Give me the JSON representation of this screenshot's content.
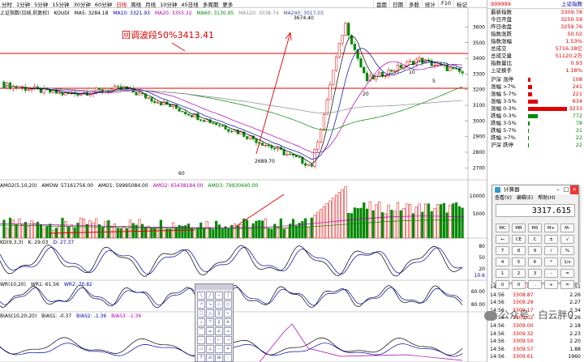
{
  "toolbar": {
    "items": [
      "分时",
      "1分钟",
      "5分钟",
      "15分钟",
      "30分钟",
      "60分钟",
      "日线",
      "周线",
      "月线",
      "10分钟",
      "45日线",
      "多周期",
      "更多"
    ],
    "active_index": 6,
    "right_tabs": [
      "盘面",
      "日期",
      "多股",
      "统计",
      "F10",
      "标记"
    ]
  },
  "main_indicator": {
    "title": "上证指数(日线,前复权)",
    "ma_label": "KOUDI",
    "ma5": "MA5: 3284.18",
    "ma10": "MA10: 3321.93",
    "ma20": "MA20: 3355.32",
    "ma60": "MA60: 3130.95",
    "ma120": "MA120: 3038.74",
    "ma240": "MA240: 3017.03"
  },
  "annotation": {
    "text": "回调波段50%3413.41"
  },
  "price_labels": {
    "high": "3674.40",
    "low": "2689.70",
    "mark_60": "60",
    "mark_20": "20",
    "mark_10": "10",
    "mark_5": "5"
  },
  "y_axis_main": [
    "3600",
    "3500",
    "3400",
    "3300",
    "3200",
    "3100",
    "3000",
    "2900",
    "2800",
    "2700"
  ],
  "vol_indicator": {
    "title": "AMO2(5,10,20)",
    "amo": "AMOW: 57161756.00",
    "amo1": "AMO1: 59995084.00",
    "amo2": "AMO2: 65438184.00",
    "amo3": "AMO3: 79930640.00"
  },
  "y_axis_vol": [
    "10000",
    "5000"
  ],
  "kdj_indicator": {
    "title": "KD(9,3,3)",
    "k": "K: 29.03",
    "d": "D: 27.37"
  },
  "y_axis_kdj": [
    "80",
    "50",
    "20",
    "10.6"
  ],
  "wr_indicator": {
    "title": "WR(10,20)",
    "wr1": "WR1: 61.56",
    "wr2": "WR2: 70.82"
  },
  "y_axis_wr": [
    "60.00",
    "80.00"
  ],
  "bias_indicator": {
    "title": "BIAS(10,20,20)",
    "b1": "BIAS1: -0.37",
    "b2": "BIAS2: -1.36",
    "b3": "BIAS3: -1.36"
  },
  "side": {
    "header_code": "999999",
    "header_name": "上证指数",
    "quotes": [
      {
        "label": "最新指数",
        "value": "3309.78"
      },
      {
        "label": "今日开盘",
        "value": "3250.59"
      },
      {
        "label": "昨日收盘",
        "value": "3259.76"
      },
      {
        "label": "指数涨跌",
        "value": "50.02"
      },
      {
        "label": "指数涨幅",
        "value": "1.53%"
      },
      {
        "label": "总成交",
        "value": "5716.18亿"
      },
      {
        "label": "总成交量",
        "value": "51120.2万"
      },
      {
        "label": "指数量比",
        "value": "0.93"
      },
      {
        "label": "上证换手",
        "value": "1.18%"
      }
    ],
    "dist": [
      {
        "label": "沪深 涨停",
        "value": "108",
        "color": "#e00000",
        "w": 3
      },
      {
        "label": "涨幅 >7%",
        "value": "241",
        "color": "#e00000",
        "w": 5
      },
      {
        "label": "涨幅 5-7%",
        "value": "221",
        "color": "#e00000",
        "w": 5
      },
      {
        "label": "涨幅 3-5%",
        "value": "634",
        "color": "#e00000",
        "w": 12
      },
      {
        "label": "涨幅 0-3%",
        "value": "3233",
        "color": "#e00000",
        "w": 48
      },
      {
        "label": "跌幅 0-3%",
        "value": "772",
        "color": "#080",
        "w": 12
      },
      {
        "label": "跌幅 3-5%",
        "value": "78",
        "color": "#080",
        "w": 2
      },
      {
        "label": "跌幅 5-7%",
        "value": "31",
        "color": "#080",
        "w": 1
      },
      {
        "label": "跌幅 >7%",
        "value": "22",
        "color": "#080",
        "w": 1
      },
      {
        "label": "沪深 跌停",
        "value": "22",
        "color": "#080",
        "w": 1
      }
    ]
  },
  "calculator": {
    "title": "计算器",
    "menu": [
      "查看(V)",
      "编辑(E)",
      "帮助(H)"
    ],
    "display": "3317.615",
    "keys": [
      "MC",
      "MR",
      "MS",
      "M+",
      "M-",
      "←",
      "CE",
      "C",
      "±",
      "√",
      "7",
      "8",
      "9",
      "/",
      "%",
      "4",
      "5",
      "6",
      "*",
      "1/x",
      "1",
      "2",
      "3",
      "-",
      "=",
      "0",
      "0",
      ".",
      "+",
      "="
    ]
  },
  "trades": [
    {
      "t": "14:56",
      "p": "3308.87",
      "v": "2.51"
    },
    {
      "t": "14:56",
      "p": "3308.87",
      "v": "2.26"
    },
    {
      "t": "14:56",
      "p": "3309.29",
      "v": "2.27"
    },
    {
      "t": "14:56",
      "p": "3309.17",
      "v": "2.34"
    },
    {
      "t": "14:56",
      "p": "3309.02",
      "v": "2.26"
    },
    {
      "t": "14:56",
      "p": "3309.00",
      "v": "2.18"
    },
    {
      "t": "14:56",
      "p": "3309.32",
      "v": "2.23"
    },
    {
      "t": "14:56",
      "p": "3309.50",
      "v": "2.20"
    },
    {
      "t": "14:56",
      "p": "3309.57",
      "v": "1.88"
    },
    {
      "t": "14:56",
      "p": "3309.61",
      "v": "1960"
    }
  ],
  "watermark": "公众号 · 白云胖0"
}
